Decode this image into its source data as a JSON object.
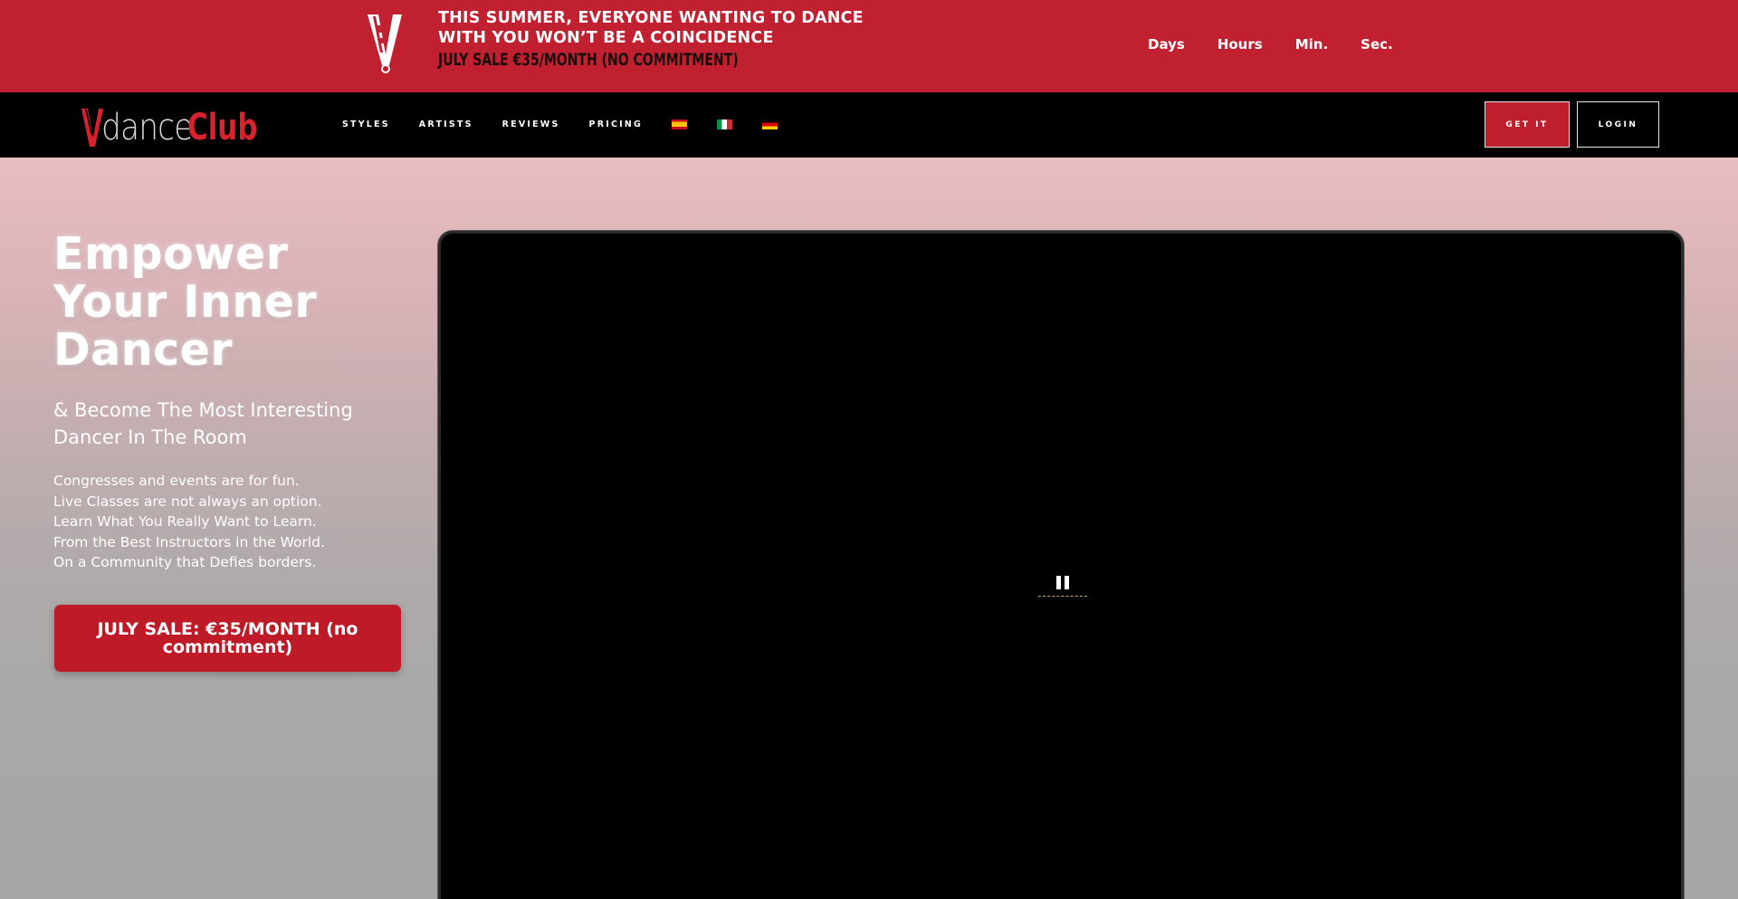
{
  "promo": {
    "headline_line1": "THIS SUMMER, EVERYONE WANTING TO DANCE",
    "headline_line2": "WITH YOU WON’T BE A COINCIDENCE",
    "sale": "JULY SALE €35/MONTH (NO COMMITMENT)",
    "countdown": {
      "days": "Days",
      "hours": "Hours",
      "minutes": "Min.",
      "seconds": "Sec."
    }
  },
  "navbar": {
    "brand_dance": "dance",
    "brand_club": "Club",
    "links": [
      "STYLES",
      "ARTISTS",
      "REVIEWS",
      "PRICING"
    ],
    "flags": [
      "spain-flag-icon",
      "italy-flag-icon",
      "germany-flag-icon"
    ],
    "get_it": "GET IT",
    "login": "LOGIN"
  },
  "hero": {
    "title_line1": "Empower",
    "title_line2": "Your Inner",
    "title_line3": "Dancer",
    "subtitle_line1": "& Become The Most Interesting",
    "subtitle_line2": "Dancer In The Room",
    "body": [
      "Congresses and events are for fun.",
      "Live Classes are not always an option.",
      "Learn What You Really Want to Learn.",
      "From the Best Instructors in the World.",
      "On a Community that Defies borders."
    ],
    "cta": "JULY SALE: €35/MONTH (no commitment)"
  },
  "video": {
    "control_icon": "pause-icon"
  },
  "colors": {
    "brand_red": "#c0202f",
    "nav_bg": "#000000",
    "cta_red": "#bf1a27"
  }
}
